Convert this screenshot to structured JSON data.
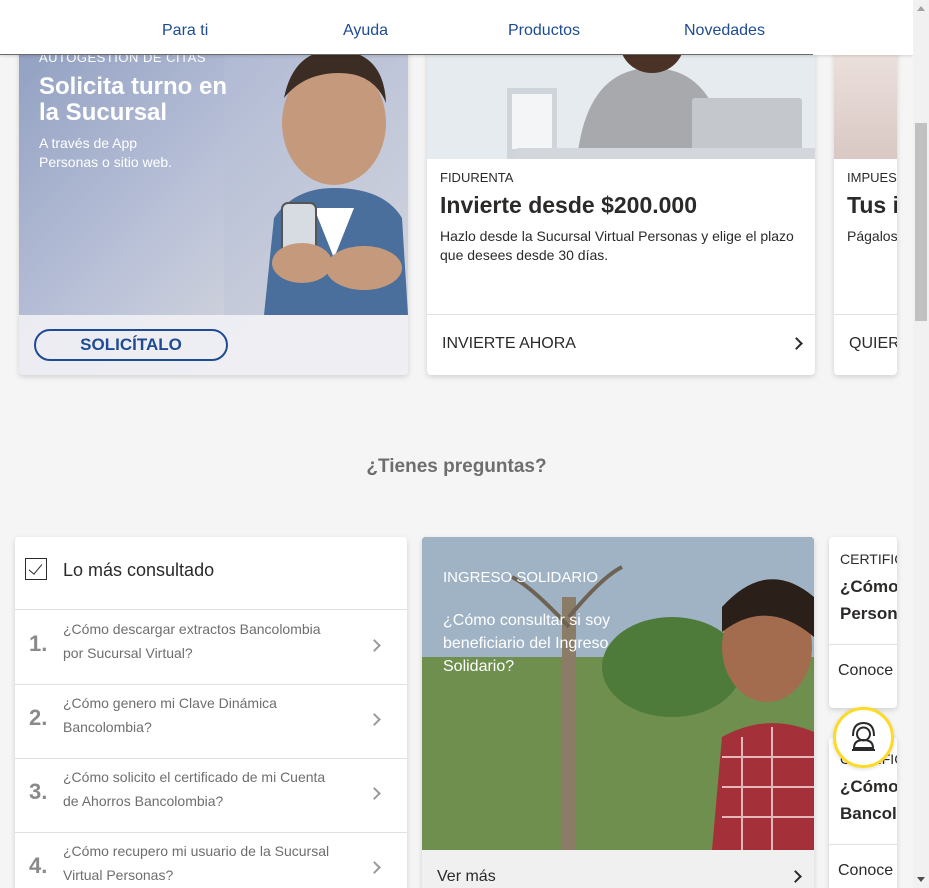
{
  "nav": {
    "items": [
      "Para ti",
      "Ayuda",
      "Productos",
      "Novedades"
    ]
  },
  "promo": {
    "kicker": "AUTOGESTIÓN DE CITAS",
    "title": "Solicita turno en la Sucursal",
    "subtitle": "A través de App Personas o sitio web.",
    "button": "SOLICÍTALO"
  },
  "product": {
    "kicker": "FIDURENTA",
    "title": "Invierte desde $200.000",
    "description": "Hazlo desde la Sucursal Virtual Personas y elige el plazo que desees desde 30 días.",
    "cta": "INVIERTE AHORA"
  },
  "partial_card": {
    "kicker": "IMPUES",
    "title": "Tus i",
    "description": "Págalos sin salir",
    "cta": "QUIER"
  },
  "questions": {
    "section_title": "¿Tienes preguntas?",
    "list_title": "Lo más consultado",
    "items": [
      {
        "num": "1.",
        "text": "¿Cómo descargar extractos Bancolombia por Sucursal Virtual?"
      },
      {
        "num": "2.",
        "text": "¿Cómo genero mi Clave Dinámica Bancolombia?"
      },
      {
        "num": "3.",
        "text": "¿Cómo solicito el certificado de mi Cuenta de Ahorros Bancolombia?"
      },
      {
        "num": "4.",
        "text": "¿Cómo recupero mi usuario de la Sucursal Virtual Personas?"
      }
    ]
  },
  "feature": {
    "kicker": "INGRESO SOLIDARIO",
    "title": "¿Cómo consultar si soy beneficiario del Ingreso Solidario?",
    "cta": "Ver más"
  },
  "cert_cards": [
    {
      "kicker": "CERTIFIC",
      "title_lines": [
        "¿Cómo",
        "Persona"
      ],
      "cta": "Conoce r"
    },
    {
      "kicker": "CERTIFIC",
      "title_lines": [
        "¿Cómo",
        "Bancolo"
      ],
      "cta": "Conoce r"
    }
  ],
  "icons": {
    "help": "support-agent-icon",
    "chevron": "chevron-right-icon",
    "check": "checkbox-icon"
  },
  "colors": {
    "brand_blue": "#1e4b91",
    "brand_yellow": "#fdda24"
  }
}
